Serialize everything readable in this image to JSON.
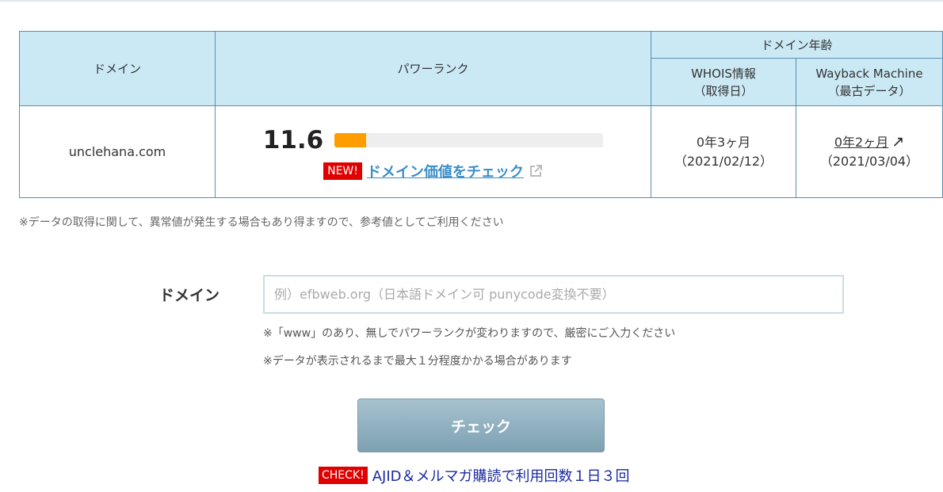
{
  "table": {
    "header_domain": "ドメイン",
    "header_rank": "パワーランク",
    "header_age": "ドメイン年齢",
    "header_whois_line1": "WHOIS情報",
    "header_whois_line2": "（取得日）",
    "header_wayback_line1": "Wayback Machine",
    "header_wayback_line2": "（最古データ）",
    "row": {
      "domain": "unclehana.com",
      "power_rank": "11.6",
      "power_rank_bar_fraction": 0.116,
      "new_badge": "NEW!",
      "value_check_link": "ドメイン価値をチェック",
      "whois_age": "0年3ヶ月",
      "whois_date": "（2021/02/12）",
      "wayback_age": "0年2ヶ月",
      "wayback_date": "（2021/03/04）"
    }
  },
  "notes": {
    "data_disclaimer": "※データの取得に関して、異常値が発生する場合もあり得ますので、参考値としてご利用ください"
  },
  "form": {
    "label": "ドメイン",
    "placeholder": "例）efbweb.org（日本語ドメイン可 punycode変換不要）",
    "value": "",
    "note_www": "※「www」のあり、無しでパワーランクが変わりますので、厳密にご入力ください",
    "note_time": "※データが表示されるまで最大１分程度かかる場合があります",
    "submit_label": "チェック"
  },
  "promo": {
    "badge": "CHECK!",
    "link": "AJID＆メルマガ購読で利用回数１日３回"
  },
  "colors": {
    "header_bg": "#cbe9f5",
    "border": "#5a8fae",
    "rank_bar": "#ff9d00",
    "badge_red": "#e00000",
    "link_blue": "#3a8ec8"
  }
}
